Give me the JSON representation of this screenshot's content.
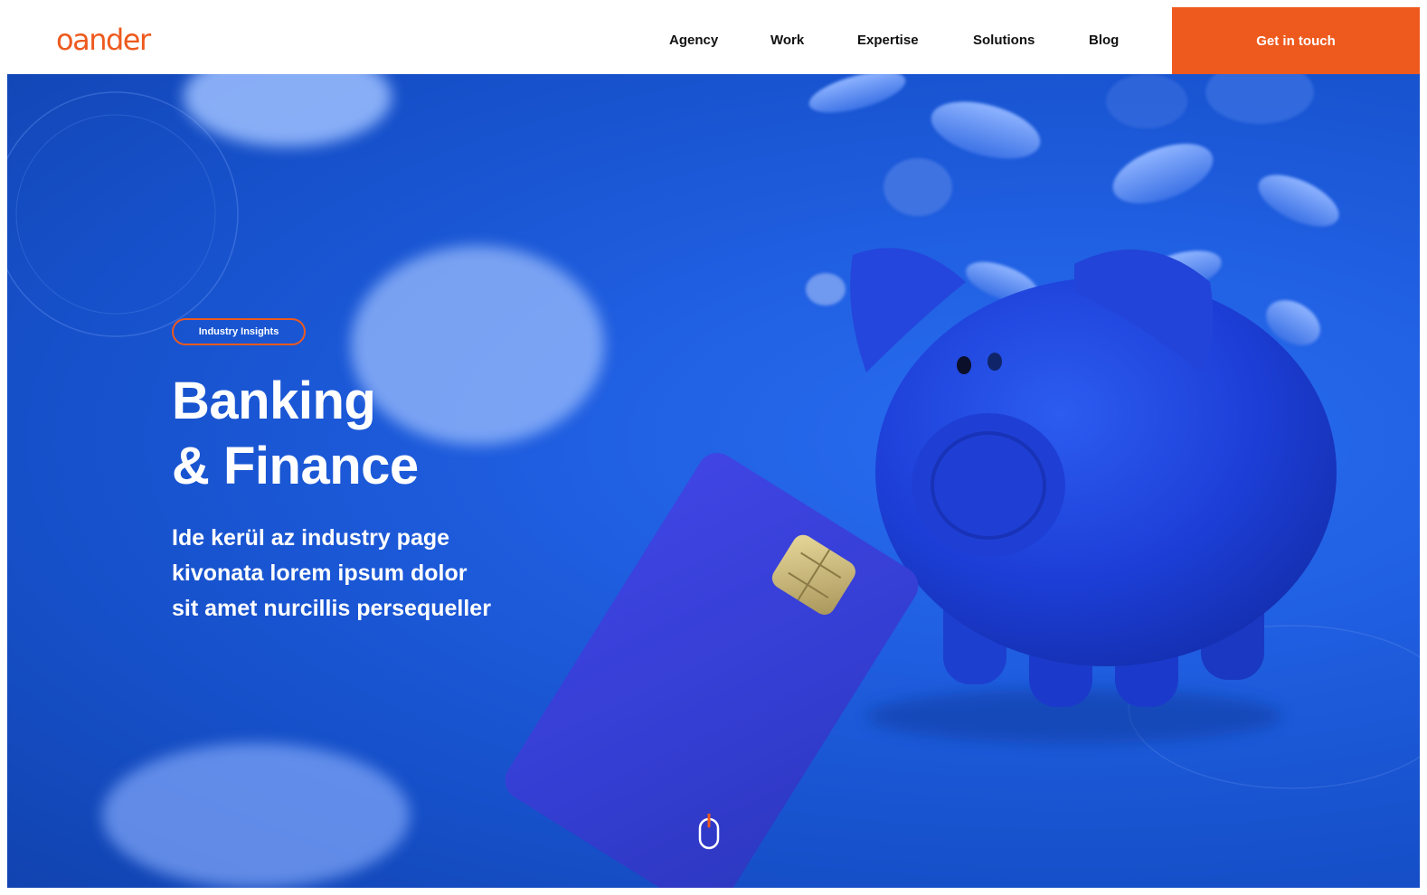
{
  "header": {
    "logo": "oander",
    "nav": [
      "Agency",
      "Work",
      "Expertise",
      "Solutions",
      "Blog"
    ],
    "cta": "Get in touch"
  },
  "hero": {
    "badge": "Industry Insights",
    "title_line1": "Banking",
    "title_line2": "& Finance",
    "subtitle_line1": "Ide kerül az industry page",
    "subtitle_line2": "kivonata lorem ipsum dolor",
    "subtitle_line3": "sit amet nurcillis persequeller"
  },
  "icons": {
    "scroll": "mouse-scroll-icon"
  },
  "colors": {
    "brand": "#ee5a1e",
    "hero_blue": "#1f5ee0",
    "text_dark": "#111111",
    "text_light": "#ffffff"
  }
}
